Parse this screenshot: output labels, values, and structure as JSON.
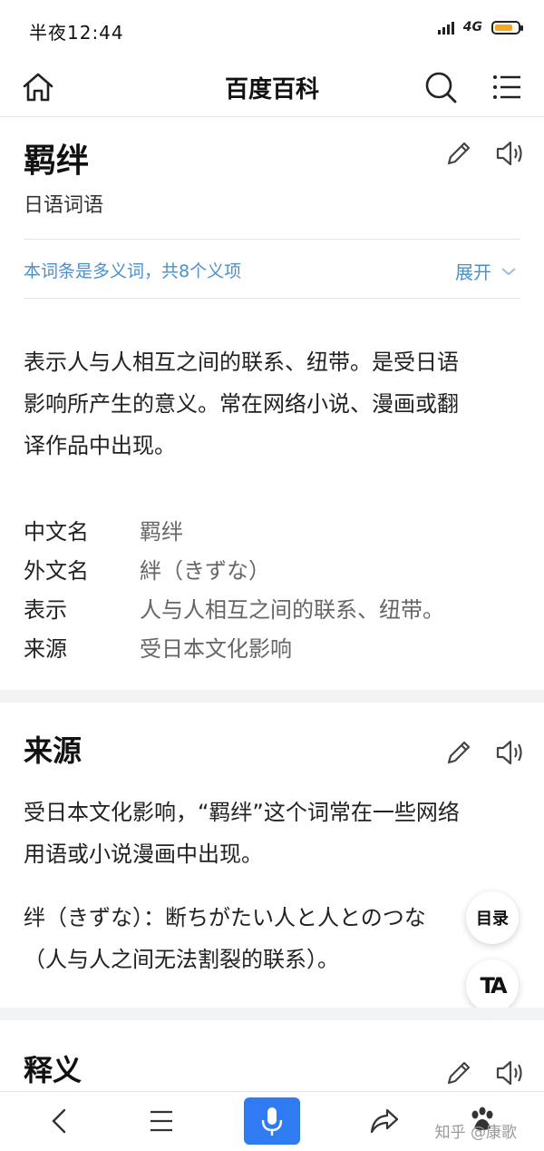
{
  "status": {
    "time": "半夜12:44",
    "network": "4G"
  },
  "header": {
    "title": "百度百科"
  },
  "entry": {
    "title": "羁绊",
    "subtitle": "日语词语",
    "polysemy_note": "本词条是多义词，共8个义项",
    "expand_label": "展开",
    "summary": [
      "表示人与人相互之间的联系、纽带。是受日语",
      "影响所产生的意义。常在网络小说、漫画或翻",
      "译作品中出现。"
    ],
    "info": [
      {
        "key": "中文名",
        "value": "羁绊"
      },
      {
        "key": "外文名",
        "value": "絆（きずな）"
      },
      {
        "key": "表示",
        "value": "人与人相互之间的联系、纽带。"
      },
      {
        "key": "来源",
        "value": "受日本文化影响"
      }
    ]
  },
  "sections": {
    "origin": {
      "title": "来源",
      "para1": [
        "受日本文化影响，“羁绊”这个词常在一些网络",
        "用语或小说漫画中出现。"
      ],
      "para2": [
        "绊（きずな）：断ちがたい人と人とのつな",
        "（人与人之间无法割裂的联系）。"
      ]
    },
    "meaning": {
      "title": "释义"
    }
  },
  "fab": {
    "toc": "目录",
    "text_size": "TA"
  },
  "watermark": "知乎 @康歌",
  "colors": {
    "link": "#4a8fd0",
    "mic": "#2f7bf2",
    "battery": "#f5a623"
  },
  "icons": [
    "home-icon",
    "search-icon",
    "menu-icon",
    "edit-icon",
    "audio-icon",
    "back-icon",
    "list-icon",
    "mic-icon",
    "share-icon",
    "paw-icon"
  ]
}
